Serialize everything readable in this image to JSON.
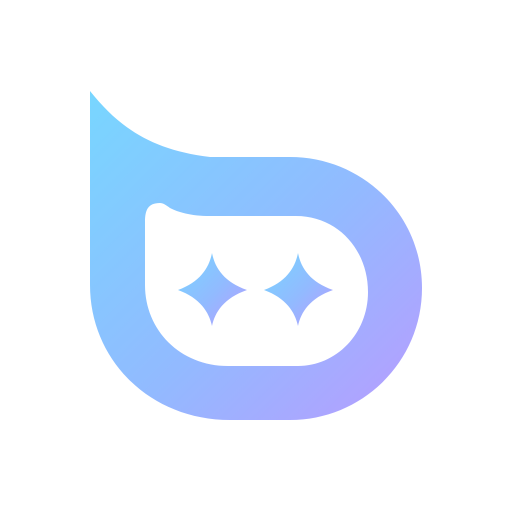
{
  "logo": {
    "name": "app-logo",
    "colors": {
      "gradient_start": "#78D6FF",
      "gradient_mid": "#92BAFF",
      "gradient_end": "#B89CFF",
      "background": "#FFFFFF"
    }
  },
  "icons": [
    "sparkle-icon",
    "sparkle-icon"
  ]
}
